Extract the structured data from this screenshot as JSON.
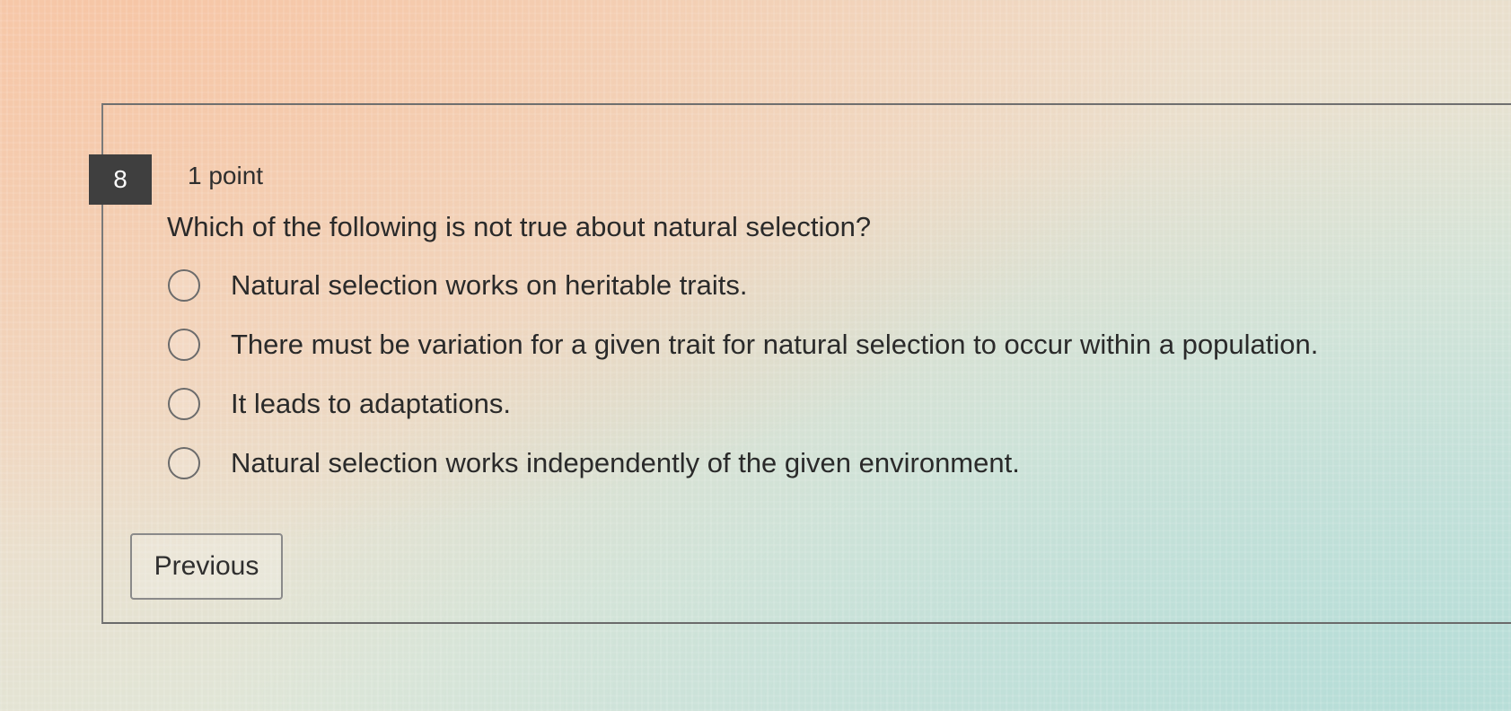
{
  "question": {
    "number": "8",
    "points": "1 point",
    "text": "Which of the following is not true about natural selection?",
    "options": [
      {
        "label": "Natural selection works on heritable traits.",
        "selected": false
      },
      {
        "label": "There must be variation for a given trait for natural selection to occur within a population.",
        "selected": false
      },
      {
        "label": "It leads to adaptations.",
        "selected": false
      },
      {
        "label": "Natural selection works independently of the given environment.",
        "selected": false
      }
    ]
  },
  "navigation": {
    "previous_label": "Previous"
  }
}
